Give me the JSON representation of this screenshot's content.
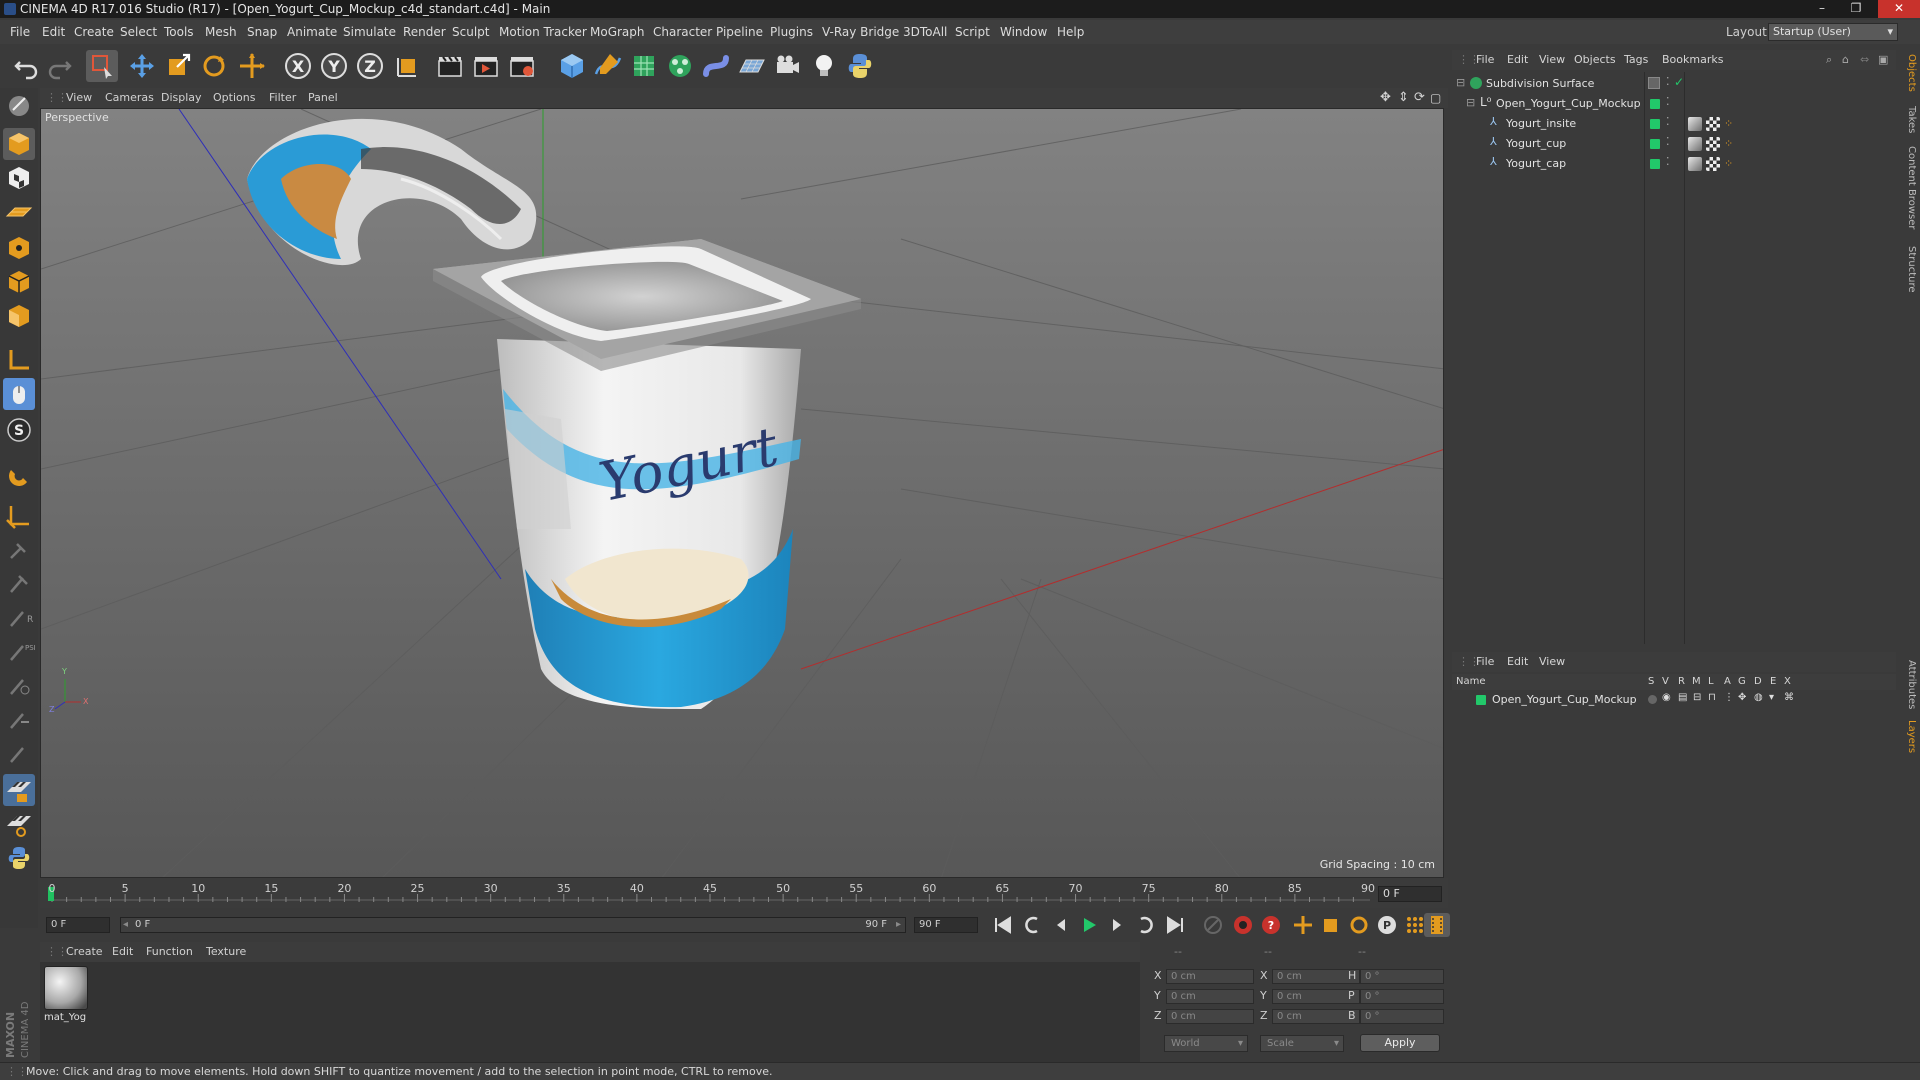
{
  "window": {
    "title": "CINEMA 4D R17.016 Studio (R17) - [Open_Yogurt_Cup_Mockup_c4d_standart.c4d] - Main",
    "controls": [
      "–",
      "❐",
      "✕"
    ]
  },
  "menubar": {
    "items": [
      "File",
      "Edit",
      "Create",
      "Select",
      "Tools",
      "Mesh",
      "Snap",
      "Animate",
      "Simulate",
      "Render",
      "Sculpt",
      "Motion Tracker",
      "MoGraph",
      "Character",
      "Pipeline",
      "Plugins",
      "V-Ray Bridge",
      "3DToAll",
      "Script",
      "Window",
      "Help"
    ],
    "layout_label": "Layout:",
    "layout_value": "Startup (User)"
  },
  "viewport": {
    "menu": [
      "View",
      "Cameras",
      "Display",
      "Options",
      "Filter",
      "Panel"
    ],
    "label": "Perspective",
    "grid_spacing": "Grid Spacing : 10 cm",
    "axis_labels": {
      "x": "X",
      "y": "Y",
      "z": "Z"
    }
  },
  "timeline": {
    "ticks": [
      "0",
      "5",
      "10",
      "15",
      "20",
      "25",
      "30",
      "35",
      "40",
      "45",
      "50",
      "55",
      "60",
      "65",
      "70",
      "75",
      "80",
      "85",
      "90"
    ],
    "current_frame": "0 F"
  },
  "transport": {
    "start_field": "0 F",
    "range_start": "0 F",
    "range_end": "90 F",
    "end_field": "90 F"
  },
  "materials": {
    "menu": [
      "Create",
      "Edit",
      "Function",
      "Texture"
    ],
    "items": [
      {
        "name": "mat_Yog"
      }
    ]
  },
  "coordinates": {
    "header": [
      "--",
      "--",
      "--"
    ],
    "rows": [
      {
        "a": "X",
        "pos": "0 cm",
        "b": "X",
        "size": "0 cm",
        "c": "H",
        "rot": "0 °"
      },
      {
        "a": "Y",
        "pos": "0 cm",
        "b": "Y",
        "size": "0 cm",
        "c": "P",
        "rot": "0 °"
      },
      {
        "a": "Z",
        "pos": "0 cm",
        "b": "Z",
        "size": "0 cm",
        "c": "B",
        "rot": "0 °"
      }
    ],
    "mode": "World",
    "transform": "Scale",
    "apply_label": "Apply"
  },
  "object_manager": {
    "menu": [
      "File",
      "Edit",
      "View",
      "Objects",
      "Tags",
      "Bookmarks"
    ],
    "objects": [
      {
        "name": "Subdivision Surface",
        "level": 0
      },
      {
        "name": "Open_Yogurt_Cup_Mockup",
        "level": 1
      },
      {
        "name": "Yogurt_insite",
        "level": 2
      },
      {
        "name": "Yogurt_cup",
        "level": 2
      },
      {
        "name": "Yogurt_cap",
        "level": 2
      }
    ]
  },
  "layer_manager": {
    "menu": [
      "File",
      "Edit",
      "View"
    ],
    "columns": [
      "Name",
      "S",
      "V",
      "R",
      "M",
      "L",
      "A",
      "G",
      "D",
      "E",
      "X"
    ],
    "layers": [
      {
        "name": "Open_Yogurt_Cup_Mockup",
        "color": "#22c86a"
      }
    ]
  },
  "right_tabs": [
    "Objects",
    "Takes",
    "Content Browser",
    "Structure",
    "Attributes",
    "Layers"
  ],
  "status": "Move: Click and drag to move elements. Hold down SHIFT to quantize movement / add to the selection in point mode, CTRL to remove.",
  "logo": "MAXON CINEMA 4D",
  "colors": {
    "accent": "#22c86a",
    "cup_blue": "#29a3dc",
    "close": "#c8322c"
  }
}
